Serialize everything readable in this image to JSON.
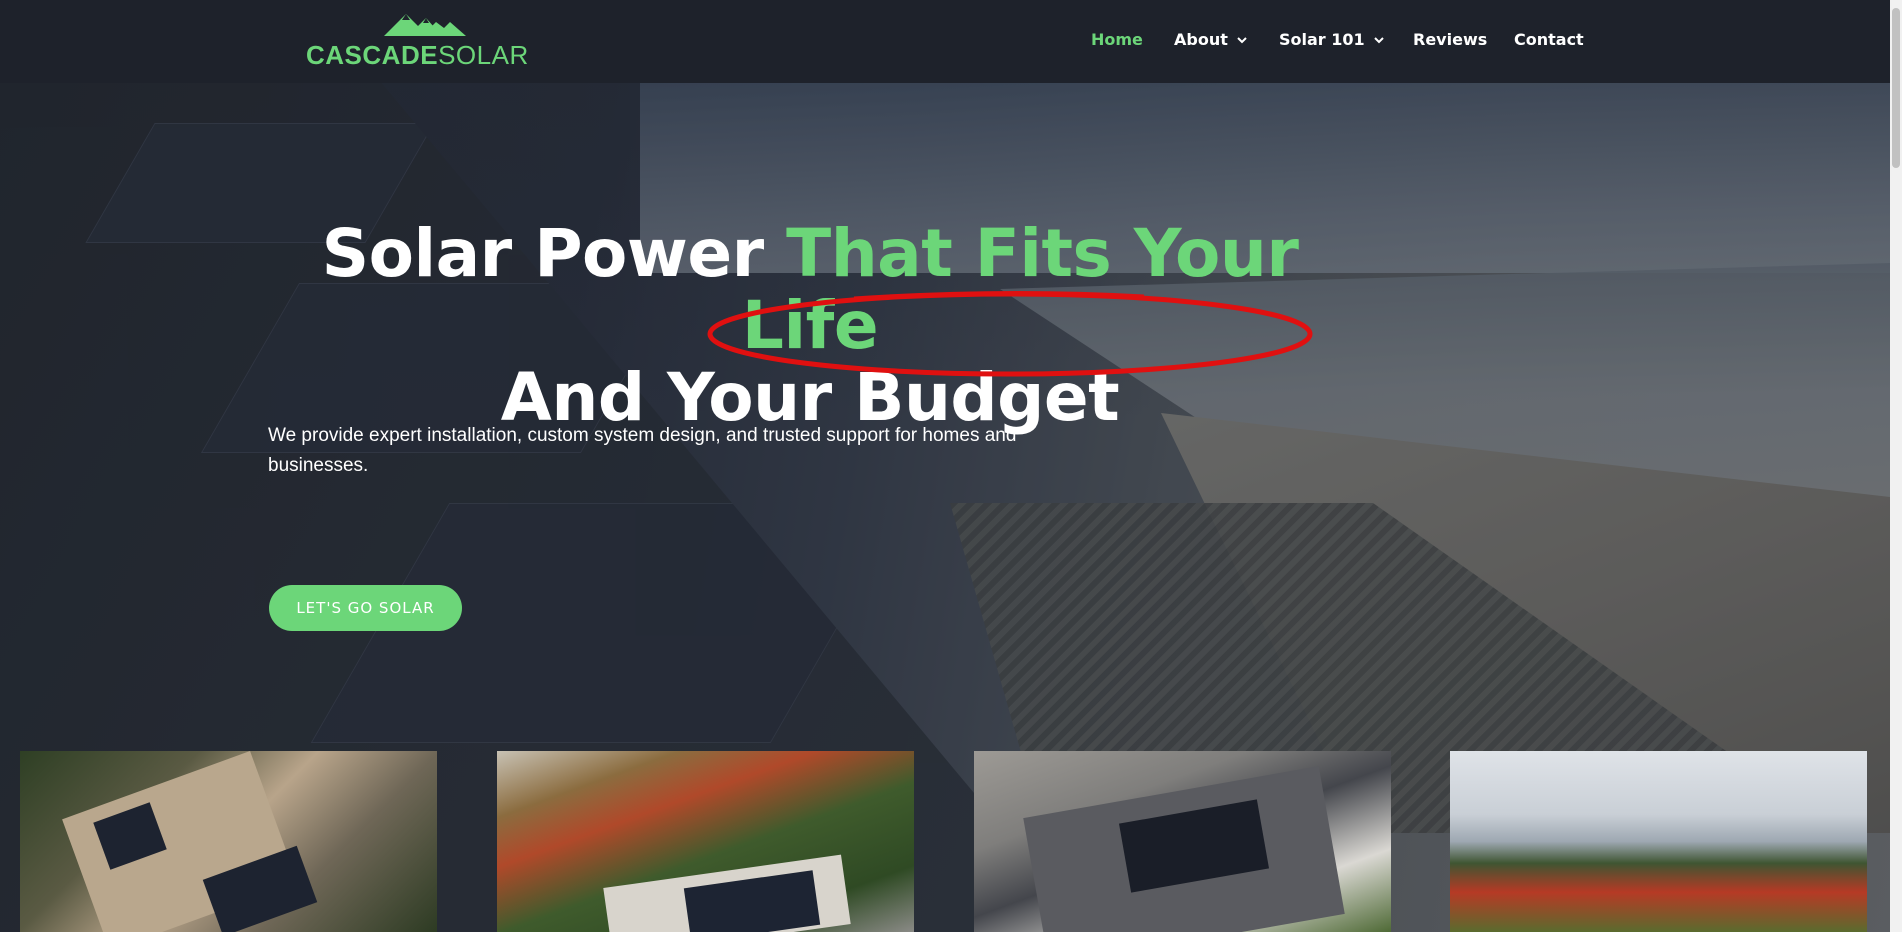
{
  "brand": {
    "name_bold": "CASCADE",
    "name_light": "SOLAR",
    "logo_icon": "mountain-icon",
    "accent_color": "#6cd679"
  },
  "nav": {
    "items": [
      {
        "label": "Home",
        "active": true,
        "dropdown": false
      },
      {
        "label": "About",
        "active": false,
        "dropdown": true
      },
      {
        "label": "Solar 101",
        "active": false,
        "dropdown": true
      },
      {
        "label": "Reviews",
        "active": false,
        "dropdown": false
      },
      {
        "label": "Contact",
        "active": false,
        "dropdown": false
      }
    ]
  },
  "hero": {
    "title_part1": "Solar Power ",
    "title_accent": "That Fits Your Life",
    "title_part2": "And Your Budget",
    "subtitle": "We provide expert installation, custom system design, and trusted support for homes and businesses.",
    "cta_label": "LET'S GO SOLAR"
  },
  "gallery": {
    "images": [
      "solar-roof-aerial-1",
      "solar-roof-aerial-2",
      "solar-roof-aerial-3",
      "autumn-city-view"
    ]
  }
}
